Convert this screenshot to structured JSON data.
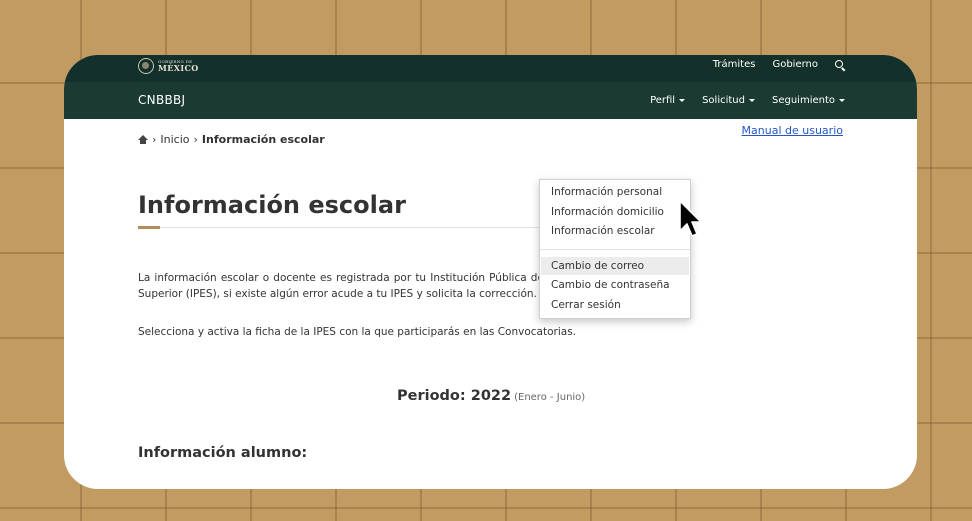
{
  "topbar": {
    "logo": {
      "small": "GOBIERNO DE",
      "big": "MÉXICO"
    },
    "links": [
      "Trámites",
      "Gobierno"
    ]
  },
  "navbar": {
    "brand": "CNBBBJ",
    "menu": [
      "Perfil",
      "Solicitud",
      "Seguimiento"
    ]
  },
  "breadcrumb": {
    "sep": "›",
    "home": "Inicio",
    "current": "Información escolar"
  },
  "manual_link": "Manual de usuario",
  "page_title": "Información escolar",
  "paragraphs": [
    "La información escolar o docente es registrada por tu Institución Pública de Educación Superior (IPES), si existe algún error acude a tu IPES y solicita la corrección.",
    "Selecciona y activa la ficha de la IPES con la que participarás en las Convocatorias."
  ],
  "periodo": {
    "label": "Periodo: 2022",
    "sub": "(Enero - Junio)"
  },
  "alumno_heading": "Información alumno:",
  "dropdown": {
    "hovered_item": "Cambio de correo",
    "items": [
      "Información personal",
      "Información domicilio",
      "Información escolar",
      "Cambio de correo",
      "Cambio de contraseña",
      "Cerrar sesión"
    ]
  },
  "colors": {
    "header_dark": "#14302a",
    "navbar": "#1a3a32",
    "accent_gold": "#b38e5d",
    "link_blue": "#2456c7",
    "background_tan": "#c29b62"
  },
  "icons": [
    "seal-icon",
    "search-icon",
    "home-icon",
    "caret-down-icon",
    "mouse-cursor-icon"
  ]
}
